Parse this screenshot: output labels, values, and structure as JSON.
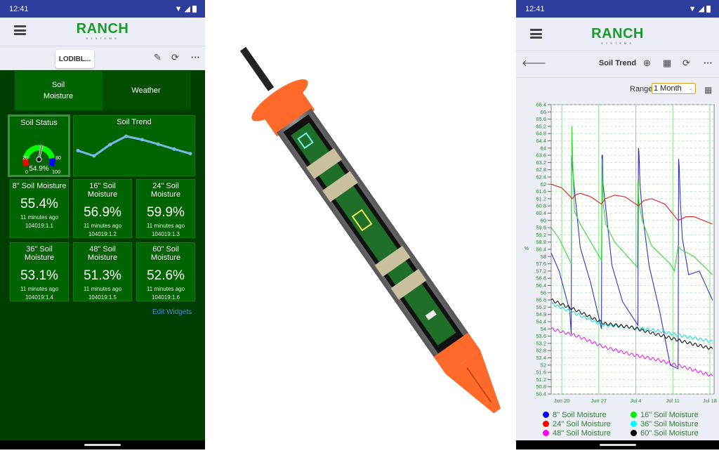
{
  "left_app": {
    "status_bar": {
      "time": "12:41"
    },
    "logo": {
      "main": "RANCH",
      "sub": "SYSTEMS"
    },
    "toolbar": {
      "site_selector": "LODIBL...",
      "edit_icon": "pencil-icon",
      "refresh_icon": "refresh-icon",
      "more_icon": "more-icon"
    },
    "tabs": [
      {
        "label": "Soil Moisture",
        "active": true
      },
      {
        "label": "Weather",
        "active": false
      }
    ],
    "soil_status": {
      "title": "Soil Status",
      "value_percent": 54.9,
      "value_label": "54.9%",
      "scale_labels": [
        "0",
        "20",
        "80",
        "100"
      ],
      "zone_colors": {
        "low": "#ff0000",
        "mid": "#00ff00",
        "high": "#0000ff"
      }
    },
    "soil_trend": {
      "title": "Soil Trend",
      "points": [
        55.4,
        54.0,
        57.0,
        59.2,
        58.3,
        57.1,
        55.8,
        54.6
      ],
      "line_color": "#7ab8e8"
    },
    "widgets": [
      {
        "title": "8\" Soil Moisture",
        "value": "55.4%",
        "time": "11 minutes ago",
        "id": "104019:1.1"
      },
      {
        "title": "16\" Soil Moisture",
        "value": "56.9%",
        "time": "11 minutes ago",
        "id": "104019:1.2"
      },
      {
        "title": "24\" Soil Moisture",
        "value": "59.9%",
        "time": "11 minutes ago",
        "id": "104019:1.3"
      },
      {
        "title": "36\" Soil Moisture",
        "value": "53.1%",
        "time": "11 minutes ago",
        "id": "104019:1.4"
      },
      {
        "title": "48\" Soil Moisture",
        "value": "51.3%",
        "time": "11 minutes ago",
        "id": "104019:1.5"
      },
      {
        "title": "60\" Soil Moisture",
        "value": "52.6%",
        "time": "11 minutes ago",
        "id": "104019:1.6"
      }
    ],
    "edit_widgets": "Edit Widgets"
  },
  "product_image": {
    "description": "soil moisture probe cutaway",
    "accent_color": "#ff6a2a"
  },
  "right_app": {
    "status_bar": {
      "time": "12:41"
    },
    "logo": {
      "main": "RANCH",
      "sub": "SYSTEMS"
    },
    "subbar": {
      "title": "Soil Trend",
      "back_icon": "back-arrow-icon",
      "zoom_icon": "zoom-in-icon",
      "chart_icon": "chart-icon",
      "refresh_icon": "refresh-icon",
      "more_icon": "more-icon"
    },
    "range": {
      "label": "Range",
      "selected": "1 Month"
    },
    "chart_data": {
      "type": "line",
      "title": "Soil Trend",
      "xlabel": "",
      "ylabel": "%",
      "ylim": [
        50.4,
        66.4
      ],
      "y_ticks": [
        "66.4",
        "66",
        "65.6",
        "65.2",
        "64.8",
        "64.4",
        "64",
        "63.6",
        "63.2",
        "62.8",
        "62.4",
        "62",
        "61.6",
        "61.2",
        "60.8",
        "60.4",
        "60",
        "59.6",
        "59.2",
        "58.8",
        "58.4",
        "58",
        "57.6",
        "57.2",
        "56.8",
        "56.4",
        "56",
        "55.6",
        "55.2",
        "54.8",
        "54.4",
        "54",
        "53.6",
        "53.2",
        "52.8",
        "52.4",
        "52",
        "51.6",
        "51.2",
        "50.8",
        "50.4"
      ],
      "x_ticks": [
        "Jun 20",
        "Jun 27",
        "Jul 4",
        "Jul 11",
        "Jul 18"
      ],
      "x_tick_days": [
        2,
        9,
        16,
        23,
        30
      ],
      "xlim_days": [
        0,
        30.8
      ],
      "grid": true,
      "legend_position": "bottom",
      "series": [
        {
          "name": "8\" Soil Moisture",
          "color": "#3333cc",
          "x": [
            0,
            1.5,
            3.5,
            3.8,
            3.85,
            4.0,
            4.3,
            5.5,
            7.5,
            9.5,
            9.6,
            9.7,
            9.8,
            10.2,
            11.5,
            13.5,
            16.4,
            16.5,
            16.6,
            16.8,
            17.2,
            18.5,
            20.5,
            22.5,
            24.0,
            24.1,
            24.2,
            24.4,
            24.8,
            26.0,
            28.0,
            30.5
          ],
          "y": [
            58.2,
            57.2,
            55.0,
            53.7,
            63.6,
            63.0,
            62.0,
            58.5,
            56.5,
            54.0,
            63.6,
            63.6,
            62.0,
            61.0,
            57.5,
            55.5,
            54.2,
            64.0,
            63.8,
            62.0,
            60.5,
            57.5,
            55.0,
            52.0,
            51.8,
            63.4,
            63.0,
            61.2,
            59.0,
            57.0,
            57.2,
            55.6
          ]
        },
        {
          "name": "16\" Soil Moisture",
          "color": "#33dd33",
          "x": [
            0,
            1.5,
            3.8,
            3.9,
            4.1,
            4.4,
            5.5,
            7.5,
            9.5,
            9.6,
            9.8,
            10.3,
            12.0,
            16.3,
            16.4,
            16.6,
            17.2,
            19.0,
            22.5,
            23.3,
            24.0,
            24.5,
            27.0,
            30.5
          ],
          "y": [
            59.6,
            59.0,
            57.6,
            65.2,
            63.0,
            60.5,
            59.8,
            58.8,
            57.8,
            63.4,
            61.0,
            59.8,
            58.8,
            57.4,
            62.2,
            61.0,
            60.0,
            58.6,
            57.6,
            57.2,
            58.6,
            58.4,
            58.0,
            57.0
          ]
        },
        {
          "name": "24\" Soil Moisture",
          "color": "#dd2222",
          "x": [
            0,
            2,
            4,
            4.5,
            5.5,
            7.5,
            9.5,
            10.2,
            12,
            14,
            16.5,
            17.5,
            19,
            21.5,
            24.0,
            25.5,
            27,
            30.5
          ],
          "y": [
            62.0,
            61.8,
            61.2,
            61.4,
            61.5,
            61.3,
            60.9,
            61.2,
            61.4,
            61.3,
            60.8,
            61.1,
            61.2,
            60.9,
            60.0,
            60.2,
            60.2,
            59.8
          ]
        },
        {
          "name": "36\" Soil Moisture",
          "color": "#22dddd",
          "x": [
            0,
            5,
            10,
            15,
            20,
            25,
            30.5
          ],
          "y": [
            55.4,
            54.8,
            54.2,
            54.1,
            53.9,
            53.6,
            53.3
          ]
        },
        {
          "name": "48\" Soil Moisture",
          "color": "#ee22ee",
          "x": [
            0,
            5,
            10,
            15,
            20,
            25,
            30.5
          ],
          "y": [
            54.0,
            53.6,
            53.0,
            52.6,
            52.3,
            51.9,
            51.4
          ]
        },
        {
          "name": "60\" Soil Moisture",
          "color": "#111111",
          "x": [
            0,
            5,
            10,
            15,
            20,
            25,
            30.5
          ],
          "y": [
            55.6,
            55.0,
            54.3,
            54.1,
            53.7,
            53.3,
            52.9
          ]
        }
      ]
    },
    "legend": [
      {
        "label": "8\" Soil Moisture",
        "color": "#0000ff"
      },
      {
        "label": "16\" Soil Moisture",
        "color": "#00ee00"
      },
      {
        "label": "24\" Soil Moisture",
        "color": "#ff0000"
      },
      {
        "label": "36\" Soil Moisture",
        "color": "#00ffff"
      },
      {
        "label": "48\" Soil Moisture",
        "color": "#ff00ff"
      },
      {
        "label": "60\" Soil Moisture",
        "color": "#000000"
      }
    ]
  }
}
